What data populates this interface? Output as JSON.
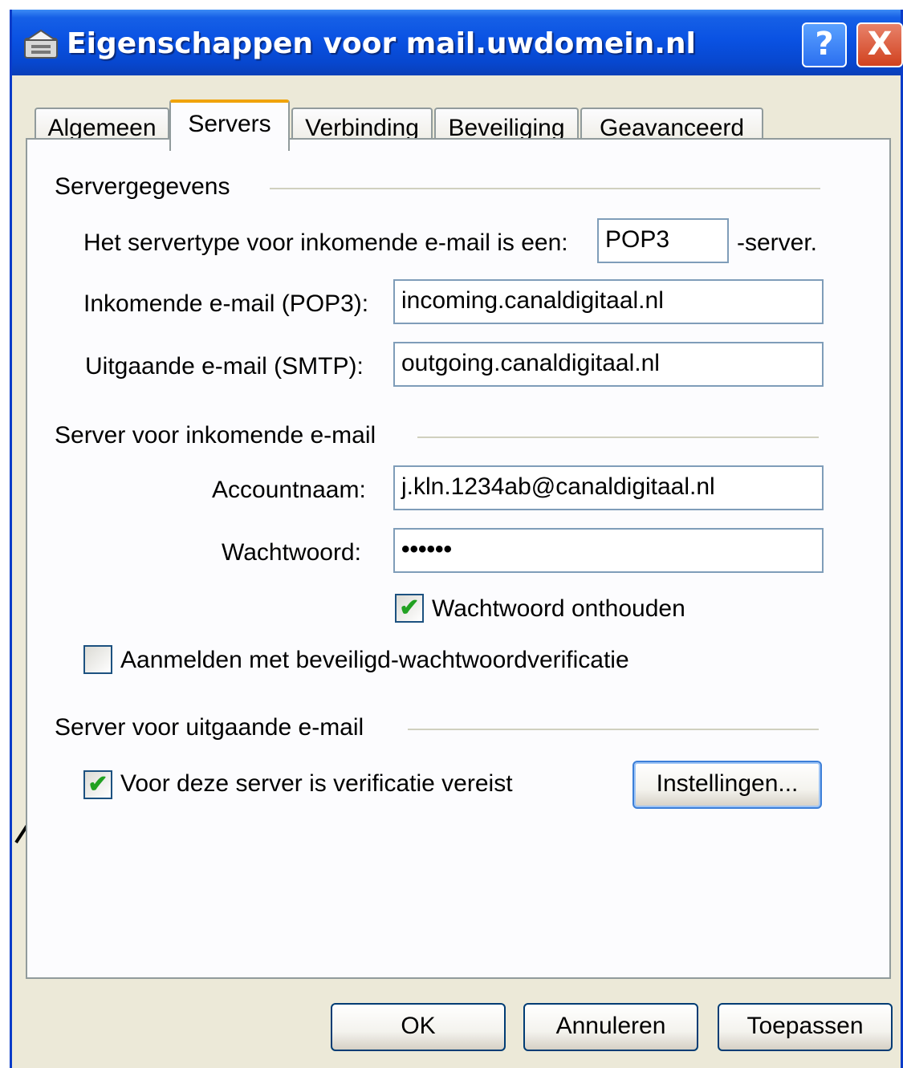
{
  "window": {
    "title": "Eigenschappen voor mail.uwdomein.nl",
    "help_button": "?",
    "close_button": "X"
  },
  "tabs": [
    {
      "label": "Algemeen",
      "active": false
    },
    {
      "label": "Servers",
      "active": true
    },
    {
      "label": "Verbinding",
      "active": false
    },
    {
      "label": "Beveiliging",
      "active": false
    },
    {
      "label": "Geavanceerd",
      "active": false
    }
  ],
  "server_info": {
    "group_label": "Servergegevens",
    "server_type_label": "Het servertype voor inkomende e-mail is een:",
    "server_type_value": "POP3",
    "server_suffix": "-server.",
    "incoming_label": "Inkomende e-mail (POP3):",
    "incoming_value": "incoming.canaldigitaal.nl",
    "outgoing_label": "Uitgaande e-mail (SMTP):",
    "outgoing_value": "outgoing.canaldigitaal.nl"
  },
  "incoming_server": {
    "group_label": "Server voor inkomende e-mail",
    "account_label": "Accountnaam:",
    "account_value": "j.kln.1234ab@canaldigitaal.nl",
    "password_label": "Wachtwoord:",
    "password_value": "••••••",
    "remember_label": "Wachtwoord onthouden",
    "remember_checked": true,
    "spa_label": "Aanmelden met beveiligd-wachtwoordverificatie",
    "spa_checked": false
  },
  "outgoing_server": {
    "group_label": "Server voor uitgaande e-mail",
    "auth_label": "Voor deze server is verificatie vereist",
    "auth_checked": true,
    "settings_button": "Instellingen..."
  },
  "buttons": {
    "ok": "OK",
    "cancel": "Annuleren",
    "apply": "Toepassen"
  },
  "checkmark": "✔",
  "colors": {
    "title_bar": "#0a52e3",
    "active_tab_accent": "#f0a30a",
    "check_green": "#21a121"
  }
}
